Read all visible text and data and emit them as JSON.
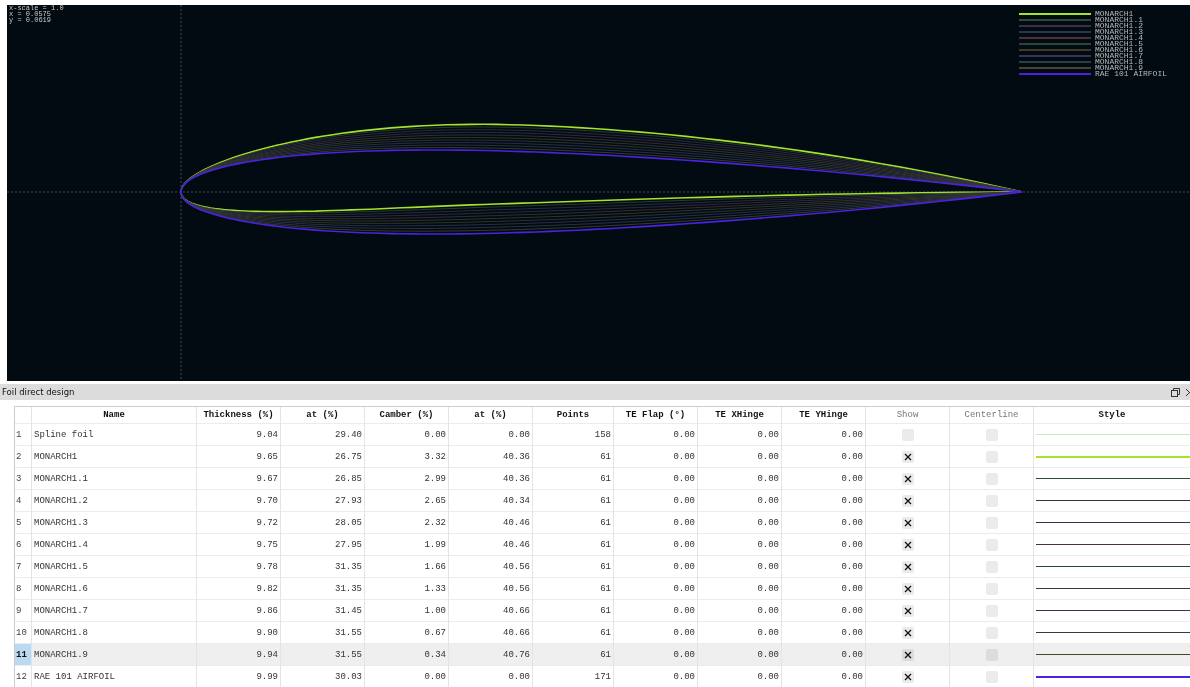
{
  "plot": {
    "readouts": [
      "x-scale = 1.0",
      "x = 0.0575",
      "y = 0.0619"
    ],
    "legend": [
      {
        "label": "MONARCH1",
        "color": "#a6e22e"
      },
      {
        "label": "MONARCH1.1",
        "color": "#2f4a2f"
      },
      {
        "label": "MONARCH1.2",
        "color": "#3a2f44"
      },
      {
        "label": "MONARCH1.3",
        "color": "#2c3550"
      },
      {
        "label": "MONARCH1.4",
        "color": "#503030"
      },
      {
        "label": "MONARCH1.5",
        "color": "#2c4538"
      },
      {
        "label": "MONARCH1.6",
        "color": "#3f3a2c"
      },
      {
        "label": "MONARCH1.7",
        "color": "#34345a"
      },
      {
        "label": "MONARCH1.8",
        "color": "#2e3e48"
      },
      {
        "label": "MONARCH1.9",
        "color": "#454530"
      },
      {
        "label": "RAE 101 AIRFOIL",
        "color": "#4a22e0"
      }
    ]
  },
  "panel": {
    "title": "Foil direct design"
  },
  "table": {
    "columns": [
      "Name",
      "Thickness (%)",
      "at (%)",
      "Camber (%)",
      "at (%)",
      "Points",
      "TE Flap (°)",
      "TE XHinge",
      "TE YHinge",
      "Show",
      "Centerline",
      "Style"
    ],
    "rows": [
      {
        "index": "1",
        "name": "Spline foil",
        "thickness": "9.04",
        "thickness_at": "29.40",
        "camber": "0.00",
        "camber_at": "0.00",
        "points": "158",
        "te_flap": "0.00",
        "te_xhinge": "0.00",
        "te_yhinge": "0.00",
        "show": false,
        "centerline": false,
        "color": "#cde8c0",
        "selected": false
      },
      {
        "index": "2",
        "name": "MONARCH1",
        "thickness": "9.65",
        "thickness_at": "26.75",
        "camber": "3.32",
        "camber_at": "40.36",
        "points": "61",
        "te_flap": "0.00",
        "te_xhinge": "0.00",
        "te_yhinge": "0.00",
        "show": true,
        "centerline": false,
        "color": "#a6e22e",
        "selected": false
      },
      {
        "index": "3",
        "name": "MONARCH1.1",
        "thickness": "9.67",
        "thickness_at": "26.85",
        "camber": "2.99",
        "camber_at": "40.36",
        "points": "61",
        "te_flap": "0.00",
        "te_xhinge": "0.00",
        "te_yhinge": "0.00",
        "show": true,
        "centerline": false,
        "color": "#2f4a2f",
        "selected": false
      },
      {
        "index": "4",
        "name": "MONARCH1.2",
        "thickness": "9.70",
        "thickness_at": "27.93",
        "camber": "2.65",
        "camber_at": "40.34",
        "points": "61",
        "te_flap": "0.00",
        "te_xhinge": "0.00",
        "te_yhinge": "0.00",
        "show": true,
        "centerline": false,
        "color": "#3a2f44",
        "selected": false
      },
      {
        "index": "5",
        "name": "MONARCH1.3",
        "thickness": "9.72",
        "thickness_at": "28.05",
        "camber": "2.32",
        "camber_at": "40.46",
        "points": "61",
        "te_flap": "0.00",
        "te_xhinge": "0.00",
        "te_yhinge": "0.00",
        "show": true,
        "centerline": false,
        "color": "#2c3550",
        "selected": false
      },
      {
        "index": "6",
        "name": "MONARCH1.4",
        "thickness": "9.75",
        "thickness_at": "27.95",
        "camber": "1.99",
        "camber_at": "40.46",
        "points": "61",
        "te_flap": "0.00",
        "te_xhinge": "0.00",
        "te_yhinge": "0.00",
        "show": true,
        "centerline": false,
        "color": "#503030",
        "selected": false
      },
      {
        "index": "7",
        "name": "MONARCH1.5",
        "thickness": "9.78",
        "thickness_at": "31.35",
        "camber": "1.66",
        "camber_at": "40.56",
        "points": "61",
        "te_flap": "0.00",
        "te_xhinge": "0.00",
        "te_yhinge": "0.00",
        "show": true,
        "centerline": false,
        "color": "#2c4538",
        "selected": false
      },
      {
        "index": "8",
        "name": "MONARCH1.6",
        "thickness": "9.82",
        "thickness_at": "31.35",
        "camber": "1.33",
        "camber_at": "40.56",
        "points": "61",
        "te_flap": "0.00",
        "te_xhinge": "0.00",
        "te_yhinge": "0.00",
        "show": true,
        "centerline": false,
        "color": "#3f3a2c",
        "selected": false
      },
      {
        "index": "9",
        "name": "MONARCH1.7",
        "thickness": "9.86",
        "thickness_at": "31.45",
        "camber": "1.00",
        "camber_at": "40.66",
        "points": "61",
        "te_flap": "0.00",
        "te_xhinge": "0.00",
        "te_yhinge": "0.00",
        "show": true,
        "centerline": false,
        "color": "#34345a",
        "selected": false
      },
      {
        "index": "10",
        "name": "MONARCH1.8",
        "thickness": "9.90",
        "thickness_at": "31.55",
        "camber": "0.67",
        "camber_at": "40.66",
        "points": "61",
        "te_flap": "0.00",
        "te_xhinge": "0.00",
        "te_yhinge": "0.00",
        "show": true,
        "centerline": false,
        "color": "#2e3e48",
        "selected": false
      },
      {
        "index": "11",
        "name": "MONARCH1.9",
        "thickness": "9.94",
        "thickness_at": "31.55",
        "camber": "0.34",
        "camber_at": "40.76",
        "points": "61",
        "te_flap": "0.00",
        "te_xhinge": "0.00",
        "te_yhinge": "0.00",
        "show": true,
        "centerline": false,
        "color": "#454530",
        "selected": true
      },
      {
        "index": "12",
        "name": "RAE 101 AIRFOIL",
        "thickness": "9.99",
        "thickness_at": "30.03",
        "camber": "0.00",
        "camber_at": "0.00",
        "points": "171",
        "te_flap": "0.00",
        "te_xhinge": "0.00",
        "te_yhinge": "0.00",
        "show": true,
        "centerline": false,
        "color": "#4a22e0",
        "selected": false
      }
    ]
  }
}
